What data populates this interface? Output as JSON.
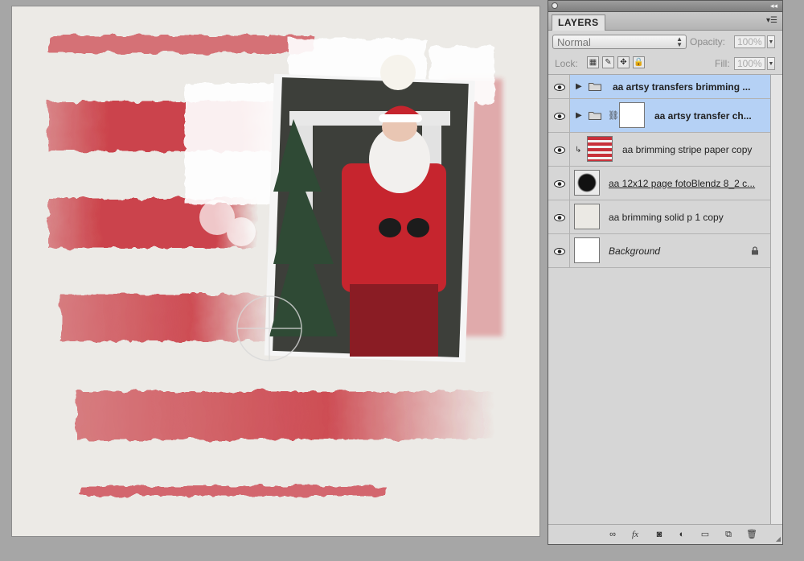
{
  "panel": {
    "tab_label": "LAYERS",
    "blend_mode": "Normal",
    "opacity_label": "Opacity:",
    "opacity_value": "100%",
    "lock_label": "Lock:",
    "fill_label": "Fill:",
    "fill_value": "100%"
  },
  "layers": [
    {
      "name": "aa artsy transfers brimming ...",
      "type": "group",
      "selected": true
    },
    {
      "name": "aa artsy transfer ch...",
      "type": "group-with-mask",
      "selected": true
    },
    {
      "name": "aa brimming stripe paper copy",
      "type": "clipped"
    },
    {
      "name": "aa 12x12 page fotoBlendz 8_2 c...",
      "type": "photo"
    },
    {
      "name": "aa brimming solid p 1 copy",
      "type": "paper"
    },
    {
      "name": "Background",
      "type": "background",
      "locked": true
    }
  ],
  "colors": {
    "stripe_red": "#c8313a",
    "paper": "#eceae6",
    "selection": "#b5d1f5"
  }
}
